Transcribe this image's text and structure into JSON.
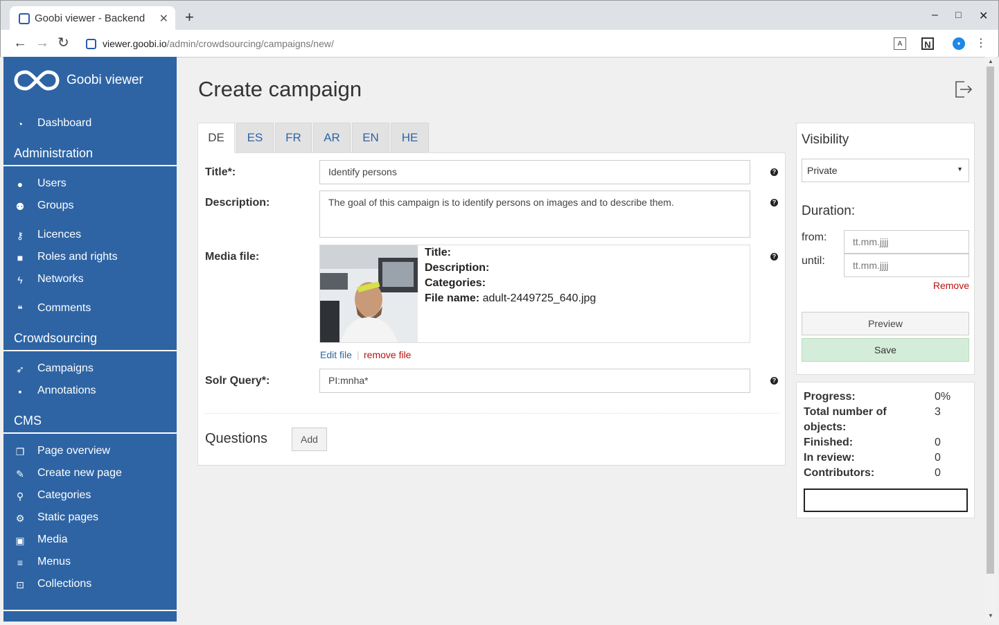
{
  "browser": {
    "tab_title": "Goobi viewer - Backend",
    "new_tab": "+",
    "url_host": "viewer.goobi.io",
    "url_path": "/admin/crowdsourcing/campaigns/new/",
    "minimize": "–",
    "maximize": "□",
    "close": "✕"
  },
  "sidebar": {
    "brand": "Goobi viewer",
    "dashboard": "Dashboard",
    "sections": {
      "administration": "Administration",
      "crowdsourcing": "Crowdsourcing",
      "cms": "CMS"
    },
    "admin_items": [
      "Users",
      "Groups",
      "Licences",
      "Roles and rights",
      "Networks",
      "Comments"
    ],
    "crowd_items": [
      "Campaigns",
      "Annotations"
    ],
    "cms_items": [
      "Page overview",
      "Create new page",
      "Categories",
      "Static pages",
      "Media",
      "Menus",
      "Collections"
    ]
  },
  "page": {
    "title": "Create campaign",
    "language_tabs": [
      "DE",
      "ES",
      "FR",
      "AR",
      "EN",
      "HE"
    ],
    "active_tab": "DE"
  },
  "form": {
    "title_label": "Title*:",
    "title_value": "Identify persons",
    "description_label": "Description:",
    "description_value": "The goal of this campaign is to identify persons on images and to describe them.",
    "media_label": "Media file:",
    "media_meta": {
      "title_label": "Title:",
      "description_label": "Description:",
      "categories_label": "Categories:",
      "filename_label": "File name:",
      "filename_value": "adult-2449725_640.jpg"
    },
    "edit_file": "Edit file",
    "link_separator": "|",
    "remove_file": "remove file",
    "solr_label": "Solr Query*:",
    "solr_value": "PI:mnha*",
    "help": "?",
    "questions_title": "Questions",
    "add_button": "Add"
  },
  "visibility": {
    "title": "Visibility",
    "selected": "Private",
    "duration_title": "Duration:",
    "from_label": "from:",
    "until_label": "until:",
    "date_placeholder": "tt.mm.jjjj",
    "remove": "Remove",
    "preview_button": "Preview",
    "save_button": "Save"
  },
  "stats": {
    "progress_label": "Progress:",
    "progress_value": "0%",
    "total_label_1": "Total number of",
    "total_label_2": "objects:",
    "total_value": "3",
    "finished_label": "Finished:",
    "finished_value": "0",
    "review_label": "In review:",
    "review_value": "0",
    "contributors_label": "Contributors:",
    "contributors_value": "0",
    "progress_fraction": 0
  },
  "colors": {
    "sidebar": "#2e64a4",
    "link": "#2e64a4",
    "danger": "#b11111",
    "save_bg": "#d4edda"
  }
}
